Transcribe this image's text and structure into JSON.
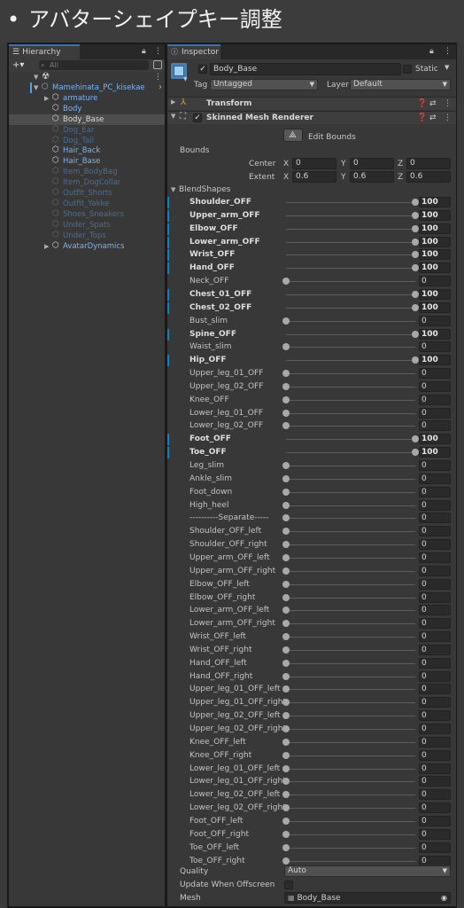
{
  "slide": {
    "bullet": "•",
    "title": "アバターシェイプキー調整"
  },
  "hierarchy": {
    "tab_label": "Hierarchy",
    "add_label": "+▾",
    "search_placeholder": "All",
    "items": [
      {
        "label": "Mamehinata_PC_kisekae",
        "indent": 0,
        "expanded": true,
        "active": true,
        "color": "#79b4f2"
      },
      {
        "label": "armature",
        "indent": 1,
        "collapsed": true,
        "active": true,
        "color": "#79b4f2"
      },
      {
        "label": "Body",
        "indent": 1,
        "active": true,
        "color": "#79b4f2"
      },
      {
        "label": "Body_Base",
        "indent": 1,
        "active": true,
        "selected": true,
        "color": "#d8d8d8"
      },
      {
        "label": "Dog_Ear",
        "indent": 1,
        "active": false,
        "color": "#4d6e91"
      },
      {
        "label": "Dog_Tail",
        "indent": 1,
        "active": false,
        "color": "#4d6e91"
      },
      {
        "label": "Hair_Back",
        "indent": 1,
        "active": true,
        "color": "#79b4f2"
      },
      {
        "label": "Hair_Base",
        "indent": 1,
        "active": true,
        "color": "#79b4f2"
      },
      {
        "label": "Item_BodyBag",
        "indent": 1,
        "active": false,
        "color": "#4d6e91"
      },
      {
        "label": "Item_DogCollar",
        "indent": 1,
        "active": false,
        "color": "#4d6e91"
      },
      {
        "label": "Outfit_Shorts",
        "indent": 1,
        "active": false,
        "color": "#4d6e91"
      },
      {
        "label": "Outfit_Yakke",
        "indent": 1,
        "active": false,
        "color": "#4d6e91"
      },
      {
        "label": "Shoes_Sneakers",
        "indent": 1,
        "active": false,
        "color": "#4d6e91"
      },
      {
        "label": "Under_Spats",
        "indent": 1,
        "active": false,
        "color": "#4d6e91"
      },
      {
        "label": "Under_Tops",
        "indent": 1,
        "active": false,
        "color": "#4d6e91"
      },
      {
        "label": "AvatarDynamics",
        "indent": 1,
        "collapsed": true,
        "active": true,
        "color": "#79b4f2"
      }
    ]
  },
  "inspector": {
    "tab_label": "Inspector",
    "object_name": "Body_Base",
    "static_label": "Static",
    "tag_label": "Tag",
    "tag_value": "Untagged",
    "layer_label": "Layer",
    "layer_value": "Default",
    "transform_label": "Transform",
    "smr_label": "Skinned Mesh Renderer",
    "edit_bounds_label": "Edit Bounds",
    "bounds_label": "Bounds",
    "center_label": "Center",
    "extent_label": "Extent",
    "center": {
      "x": "0",
      "y": "0",
      "z": "0"
    },
    "extent": {
      "x": "0.6",
      "y": "0.6",
      "z": "0.6"
    },
    "axis_labels": {
      "x": "X",
      "y": "Y",
      "z": "Z"
    },
    "blendshapes_label": "BlendShapes",
    "quality_label": "Quality",
    "quality_value": "Auto",
    "update_offscreen_label": "Update When Offscreen",
    "mesh_label": "Mesh",
    "mesh_value": "Body_Base"
  },
  "blendshapes": [
    {
      "name": "Shoulder_OFF",
      "value": 100
    },
    {
      "name": "Upper_arm_OFF",
      "value": 100
    },
    {
      "name": "Elbow_OFF",
      "value": 100
    },
    {
      "name": "Lower_arm_OFF",
      "value": 100
    },
    {
      "name": "Wrist_OFF",
      "value": 100
    },
    {
      "name": "Hand_OFF",
      "value": 100
    },
    {
      "name": "Neck_OFF",
      "value": 0
    },
    {
      "name": "Chest_01_OFF",
      "value": 100
    },
    {
      "name": "Chest_02_OFF",
      "value": 100
    },
    {
      "name": "Bust_slim",
      "value": 0
    },
    {
      "name": "Spine_OFF",
      "value": 100
    },
    {
      "name": "Waist_slim",
      "value": 0
    },
    {
      "name": "Hip_OFF",
      "value": 100
    },
    {
      "name": "Upper_leg_01_OFF",
      "value": 0
    },
    {
      "name": "Upper_leg_02_OFF",
      "value": 0
    },
    {
      "name": "Knee_OFF",
      "value": 0
    },
    {
      "name": "Lower_leg_01_OFF",
      "value": 0
    },
    {
      "name": "Lower_leg_02_OFF",
      "value": 0
    },
    {
      "name": "Foot_OFF",
      "value": 100
    },
    {
      "name": "Toe_OFF",
      "value": 100
    },
    {
      "name": "Leg_slim",
      "value": 0
    },
    {
      "name": "Ankle_slim",
      "value": 0
    },
    {
      "name": "Foot_down",
      "value": 0
    },
    {
      "name": "High_heel",
      "value": 0
    },
    {
      "name": "----------Separate-----",
      "value": 0
    },
    {
      "name": "Shoulder_OFF_left",
      "value": 0
    },
    {
      "name": "Shoulder_OFF_right",
      "value": 0
    },
    {
      "name": "Upper_arm_OFF_left",
      "value": 0
    },
    {
      "name": "Upper_arm_OFF_right",
      "value": 0
    },
    {
      "name": "Elbow_OFF_left",
      "value": 0
    },
    {
      "name": "Elbow_OFF_right",
      "value": 0
    },
    {
      "name": "Lower_arm_OFF_left",
      "value": 0
    },
    {
      "name": "Lower_arm_OFF_right",
      "value": 0
    },
    {
      "name": "Wrist_OFF_left",
      "value": 0
    },
    {
      "name": "Wrist_OFF_right",
      "value": 0
    },
    {
      "name": "Hand_OFF_left",
      "value": 0
    },
    {
      "name": "Hand_OFF_right",
      "value": 0
    },
    {
      "name": "Upper_leg_01_OFF_left",
      "value": 0
    },
    {
      "name": "Upper_leg_01_OFF_right",
      "value": 0
    },
    {
      "name": "Upper_leg_02_OFF_left",
      "value": 0
    },
    {
      "name": "Upper_leg_02_OFF_right",
      "value": 0
    },
    {
      "name": "Knee_OFF_left",
      "value": 0
    },
    {
      "name": "Knee_OFF_right",
      "value": 0
    },
    {
      "name": "Lower_leg_01_OFF_left",
      "value": 0
    },
    {
      "name": "Lower_leg_01_OFF_right",
      "value": 0
    },
    {
      "name": "Lower_leg_02_OFF_left",
      "value": 0
    },
    {
      "name": "Lower_leg_02_OFF_right",
      "value": 0
    },
    {
      "name": "Foot_OFF_left",
      "value": 0
    },
    {
      "name": "Foot_OFF_right",
      "value": 0
    },
    {
      "name": "Toe_OFF_left",
      "value": 0
    },
    {
      "name": "Toe_OFF_right",
      "value": 0
    }
  ],
  "icons": {
    "lock": "lock-icon",
    "menu": "kebab-menu-icon",
    "cube": "cube-icon",
    "scene": "unity-scene-icon"
  },
  "colors": {
    "accent": "#3a72b0",
    "modified": "#0f81c2",
    "active_object": "#79b4f2",
    "inactive_object": "#4d6e91"
  }
}
